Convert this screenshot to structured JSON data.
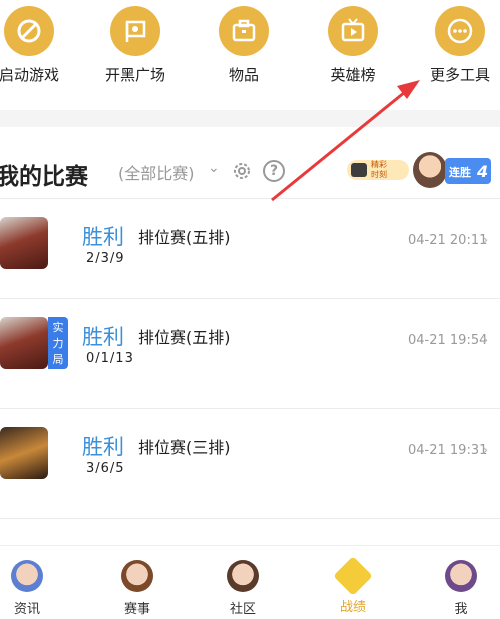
{
  "tools": [
    {
      "label": "启动游戏",
      "icon": "rocket-slash-icon"
    },
    {
      "label": "开黑广场",
      "icon": "flag-icon"
    },
    {
      "label": "物品",
      "icon": "briefcase-icon"
    },
    {
      "label": "英雄榜",
      "icon": "tv-play-icon"
    },
    {
      "label": "更多工具",
      "icon": "more-dots-icon"
    }
  ],
  "header": {
    "title": "我的比赛",
    "filter": "(全部比赛)",
    "promo_line1": "精彩",
    "promo_line2": "时刻",
    "streak_label": "连胜",
    "streak_count": "4"
  },
  "matches": [
    {
      "result": "胜利",
      "mode": "排位赛(五排)",
      "kda": "2/3/9",
      "time": "04-21 20:11",
      "badge": ""
    },
    {
      "result": "胜利",
      "mode": "排位赛(五排)",
      "kda": "0/1/13",
      "time": "04-21 19:54",
      "badge": "实力局"
    },
    {
      "result": "胜利",
      "mode": "排位赛(三排)",
      "kda": "3/6/5",
      "time": "04-21 19:31",
      "badge": ""
    }
  ],
  "nav": [
    {
      "label": "资讯",
      "icon": "news-avatar-icon"
    },
    {
      "label": "赛事",
      "icon": "match-avatar-icon"
    },
    {
      "label": "社区",
      "icon": "community-avatar-icon"
    },
    {
      "label": "战绩",
      "icon": "record-diamond-icon",
      "active": true
    },
    {
      "label": "我",
      "icon": "me-avatar-icon"
    }
  ],
  "colors": {
    "accent": "#e9b544",
    "win": "#3c8fd9",
    "active_tab": "#e2a52c",
    "annotation": "#e83a3a"
  }
}
